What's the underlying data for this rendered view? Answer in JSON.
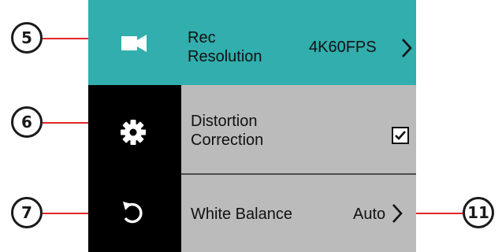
{
  "callouts": [
    {
      "number": "5"
    },
    {
      "number": "6"
    },
    {
      "number": "7"
    },
    {
      "number": "11"
    }
  ],
  "menu": {
    "rec_resolution": {
      "label_line1": "Rec",
      "label_line2": "Resolution",
      "value": "4K60FPS",
      "icon": "video-camera-icon"
    },
    "distortion_correction": {
      "label_line1": "Distortion",
      "label_line2": "Correction",
      "checked": true,
      "icon": "gear-icon"
    },
    "white_balance": {
      "label": "White Balance",
      "value": "Auto",
      "icon": "reset-icon"
    }
  },
  "colors": {
    "selected_row": "#31aead",
    "row": "#bbbbbb",
    "sidebar": "#000000",
    "callout_line": "#e0262c"
  }
}
